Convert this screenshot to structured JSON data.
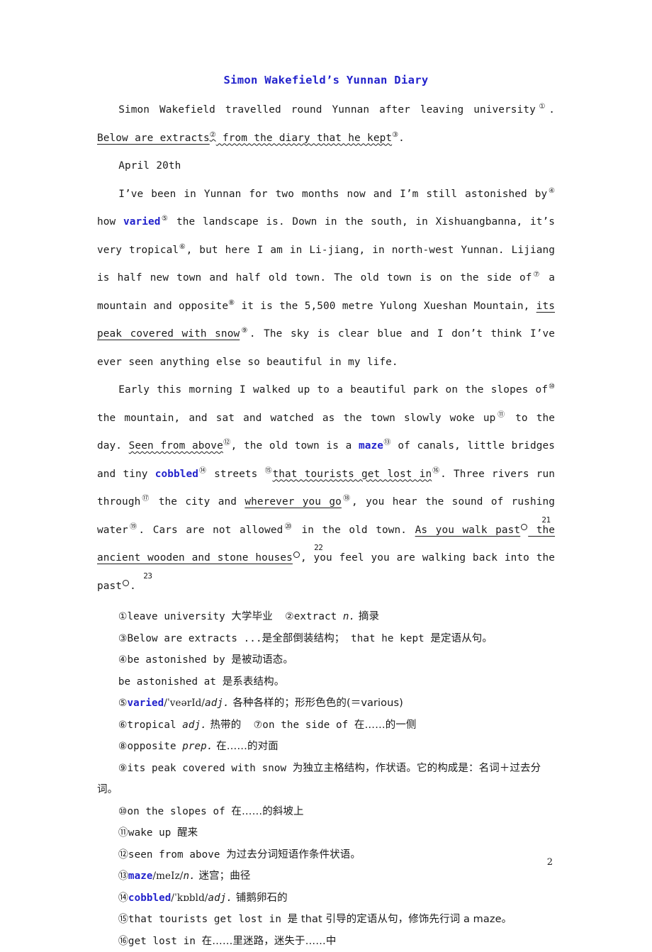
{
  "document": {
    "title": "Simon Wakefield’s Yunnan Diary",
    "title_color": "#2222cc",
    "page_number": "2"
  },
  "body": {
    "intro": {
      "s1": "Simon Wakefield travelled round Yunnan after leaving university",
      "m1": "①",
      "s2": ". ",
      "u1": "Below are extracts",
      "m2": "②",
      "u2": " from the diary that he kept",
      "m3": "③",
      "s3": "."
    },
    "date_line": "April 20th",
    "p1": {
      "t1": "I’ve been in Yunnan for two months now and I’m still astonished by",
      "m4": "④",
      "t2": " how ",
      "kw_varied": "varied",
      "m5": "⑤",
      "t3": " the landscape is. Down in the south, in Xishuangbanna, it’s very tropical",
      "m6": "⑥",
      "t4": ",  but here I am in Li-jiang, in north-west Yunnan. Lijiang is half new town and half old town. The old town is on the side of",
      "m7": "⑦",
      "t5": " a mountain and opposite",
      "m8": "⑧",
      "t6": " it is the 5,500 metre Yulong Xueshan Mountain, ",
      "u_peak": "its peak covered with snow",
      "m9": "⑨",
      "t7": ". The sky is clear blue and I don’t think I’ve ever seen anything else so beautiful in my life."
    },
    "p2": {
      "t1": "Early this morning I walked up to a beautiful park on the slopes of",
      "m10": "⑩",
      "t2": " the mountain, and sat and watched as the town slowly woke up",
      "m11": "⑪",
      "t3": " to the day. ",
      "u_seen": "Seen from above",
      "m12": "⑫",
      "t4": ", the old town is a ",
      "kw_maze": "maze",
      "m13": "⑬",
      "t5": " of canals, little bridges and tiny ",
      "kw_cobbled": "cobbled",
      "m14": "⑭",
      "t6": " streets ",
      "m15": "⑮",
      "u_that": "that tourists get lost in",
      "m16": "⑯",
      "t7": ". Three rivers run through",
      "m17": "⑰",
      "t8": " the city and ",
      "u_wherever": "wherever you go",
      "m18": "⑱",
      "t9": ", you hear the sound of rushing water",
      "m19": "⑲",
      "t10": ". Cars are not allowed",
      "m20": "⑳",
      "t11": " in the old town. ",
      "u_as1": "As you walk past",
      "m21": "21",
      "u_as2": " the ancient wooden and stone houses",
      "m22": "22",
      "t12": ",  you feel you are walking back into the past",
      "m23": "23",
      "t13": "."
    }
  },
  "notes": [
    {
      "id": "note-1",
      "marker": "①",
      "text": "leave university ",
      "cn": "大学毕业",
      "marker2": "②",
      "text2": "extract ",
      "pos2": "n.",
      "cn2": " 摘录"
    },
    {
      "id": "note-3",
      "marker": "③",
      "text": "Below are extracts ...",
      "cn": "是全部倒装结构；",
      "text2": " that he kept ",
      "cn2": "是定语从句。"
    },
    {
      "id": "note-4",
      "marker": "④",
      "text": "be astonished by ",
      "cn": "是被动语态。"
    },
    {
      "id": "note-4b",
      "marker": "",
      "text": "be astonished at ",
      "cn": "是系表结构。"
    },
    {
      "id": "note-5",
      "marker": "⑤",
      "kw": "varied",
      "phon": "/ˈveərId/",
      "pos": "adj.",
      "cn": " 各种各样的；形形色色的(＝various)"
    },
    {
      "id": "note-6",
      "marker": "⑥",
      "text": "tropical ",
      "pos": "adj.",
      "cn": " 热带的",
      "marker2": "⑦",
      "text2": "on the side of ",
      "cn2": "在……的一侧"
    },
    {
      "id": "note-8",
      "marker": "⑧",
      "text": "opposite ",
      "pos": "prep.",
      "cn": " 在……的对面"
    },
    {
      "id": "note-9",
      "marker": "⑨",
      "text": "its peak covered with snow ",
      "cn": "为独立主格结构，作状语。它的构成是：名词＋过去分词。"
    },
    {
      "id": "note-10",
      "marker": "⑩",
      "text": "on the slopes of ",
      "cn": "在……的斜坡上"
    },
    {
      "id": "note-11",
      "marker": "⑪",
      "text": "wake up ",
      "cn": "醒来"
    },
    {
      "id": "note-12",
      "marker": "⑫",
      "text": "seen from above ",
      "cn": "为过去分词短语作条件状语。"
    },
    {
      "id": "note-13",
      "marker": "⑬",
      "kw": "maze",
      "phon": "/meIz/",
      "pos": "n.",
      "cn": " 迷宫；曲径"
    },
    {
      "id": "note-14",
      "marker": "⑭",
      "kw": "cobbled",
      "phon": "/ˈkɒbld/",
      "pos": "adj.",
      "cn": " 铺鹅卵石的"
    },
    {
      "id": "note-15",
      "marker": "⑮",
      "text": "that tourists get lost in ",
      "cn": "是 that 引导的定语从句，修饰先行词 a maze。"
    },
    {
      "id": "note-16",
      "marker": "⑯",
      "text": "get lost in ",
      "cn": "在……里迷路，迷失于……中"
    }
  ]
}
